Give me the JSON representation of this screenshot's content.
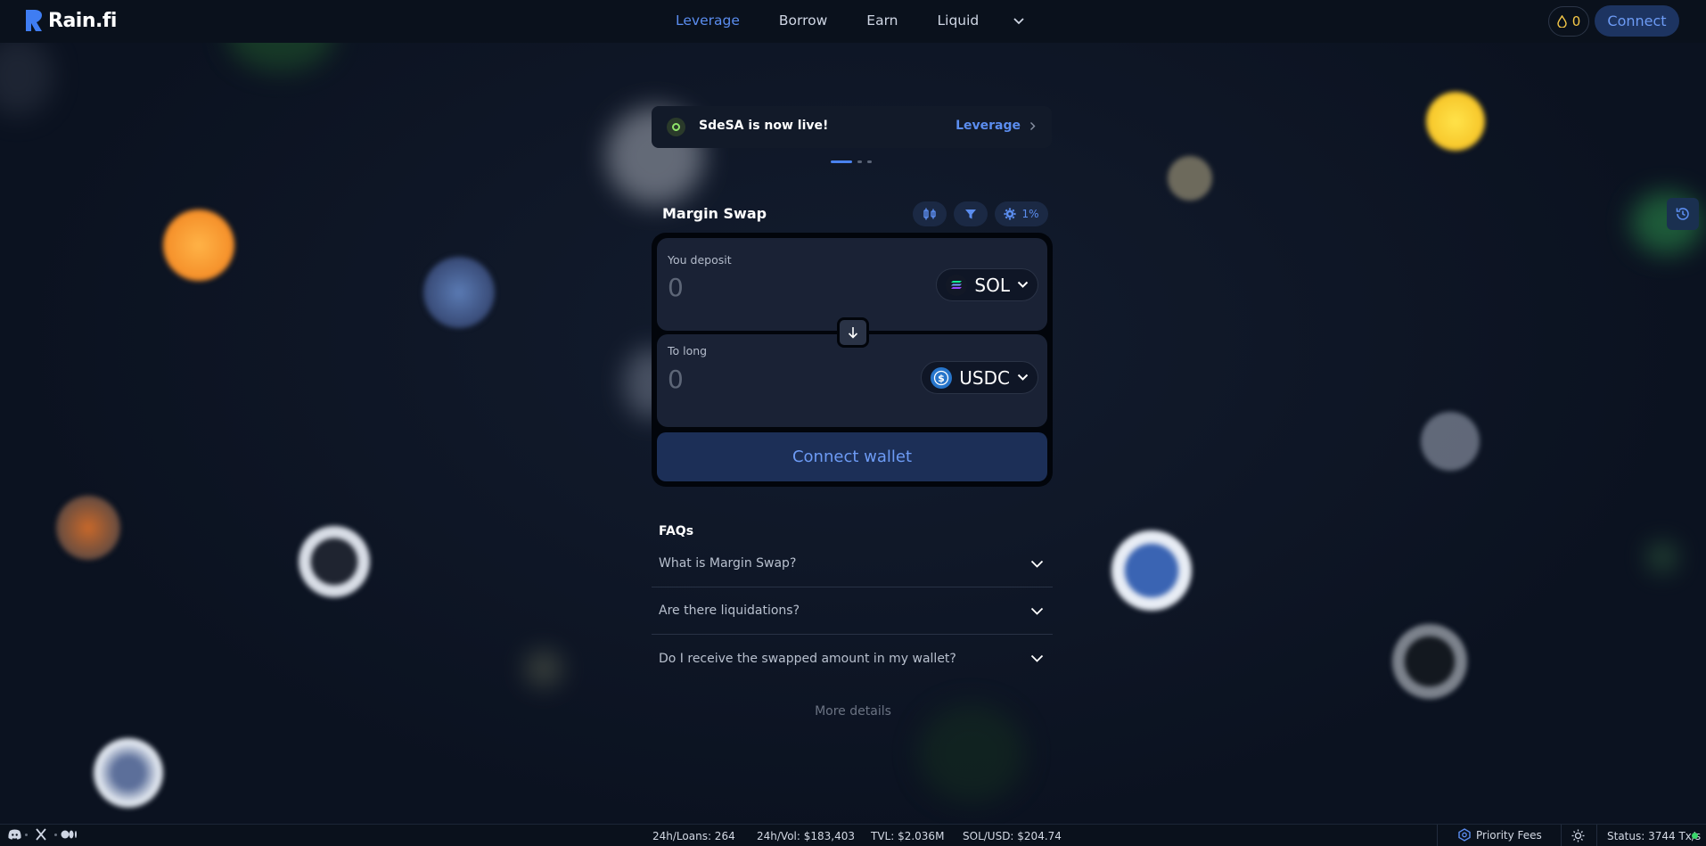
{
  "app": {
    "name": "Rain.fi"
  },
  "nav": {
    "items": [
      {
        "label": "Leverage",
        "active": true
      },
      {
        "label": "Borrow",
        "active": false
      },
      {
        "label": "Earn",
        "active": false
      },
      {
        "label": "Liquid",
        "active": false
      }
    ]
  },
  "header": {
    "points": "0",
    "connect_label": "Connect"
  },
  "banner": {
    "text": "SdeSA is now live!",
    "link_label": "Leverage",
    "slide_count": 3,
    "active_slide": 1
  },
  "swap": {
    "title": "Margin Swap",
    "slippage": "1%",
    "deposit": {
      "label": "You deposit",
      "amount": "0",
      "token": "SOL"
    },
    "long": {
      "label": "To long",
      "amount": "0",
      "token": "USDC"
    },
    "wallet_button": "Connect wallet"
  },
  "faq": {
    "title": "FAQs",
    "items": [
      "What is Margin Swap?",
      "Are there liquidations?",
      "Do I receive the swapped amount in my wallet?"
    ],
    "more": "More details"
  },
  "footer": {
    "loans": "24h/Loans: 264",
    "volume": "24h/Vol: $183,403",
    "tvl": "TVL: $2.036M",
    "price": "SOL/USD: $204.74",
    "priority": "Priority Fees",
    "status": "Status: 3744 Tx/s"
  },
  "colors": {
    "accent": "#5b8def",
    "background": "#0b1220",
    "status_ok": "#3ad66b",
    "points": "#f7c948"
  },
  "icons": [
    "logo-icon",
    "chevron-down-icon",
    "drop-icon",
    "chevron-right-icon",
    "chart-settings-icon",
    "filter-icon",
    "gear-icon",
    "sol-icon",
    "usdc-icon",
    "arrow-down-icon",
    "history-icon",
    "discord-icon",
    "x-icon",
    "medium-icon",
    "priority-icon",
    "sun-icon"
  ]
}
